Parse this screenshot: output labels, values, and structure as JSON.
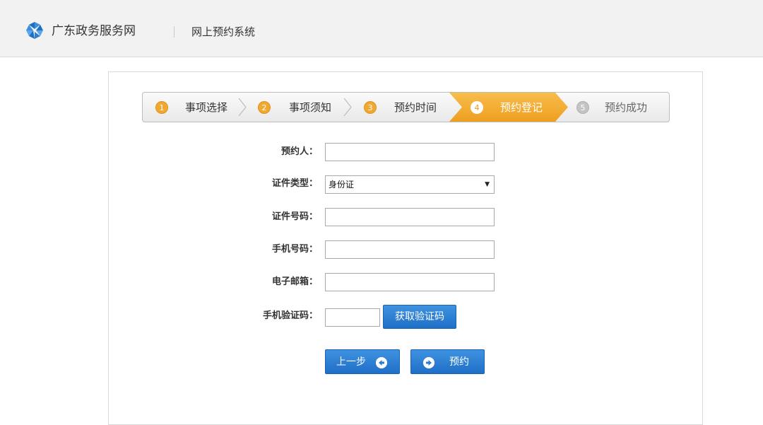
{
  "header": {
    "site_name": "广东政务服务网",
    "system_name": "网上预约系统"
  },
  "steps": [
    {
      "num": "1",
      "label": "事项选择",
      "state": "done"
    },
    {
      "num": "2",
      "label": "事项须知",
      "state": "done"
    },
    {
      "num": "3",
      "label": "预约时间",
      "state": "done"
    },
    {
      "num": "4",
      "label": "预约登记",
      "state": "active"
    },
    {
      "num": "5",
      "label": "预约成功",
      "state": "pending"
    }
  ],
  "form": {
    "name_label": "预约人：",
    "name_value": "",
    "id_type_label": "证件类型：",
    "id_type_value": "身份证",
    "id_number_label": "证件号码：",
    "id_number_value": "",
    "phone_label": "手机号码：",
    "phone_value": "",
    "email_label": "电子邮箱：",
    "email_value": "",
    "sms_code_label": "手机验证码：",
    "sms_code_value": "",
    "get_code_button": "获取验证码"
  },
  "actions": {
    "prev_button": "上一步",
    "submit_button": "预约"
  },
  "colors": {
    "accent_blue": "#2a7fd4",
    "step_active": "#f0a830"
  }
}
